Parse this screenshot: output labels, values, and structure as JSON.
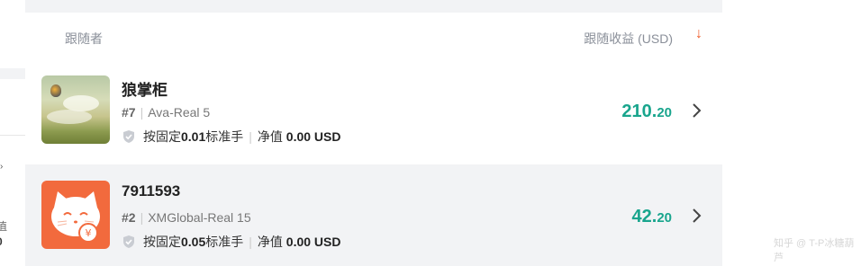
{
  "left_fragments": {
    "arrow": "›",
    "cut1": "值",
    "cut2": "0"
  },
  "header": {
    "follower_label": "跟随者",
    "profit_label": "跟随收益 (USD)",
    "sort_icon": "sort-desc-arrow"
  },
  "rows": [
    {
      "name": "狼掌柜",
      "rank": "#7",
      "account": "Ava-Real 5",
      "mode_label": "按固定",
      "lot_value": "0.01",
      "lot_unit": "标准手",
      "equity_label": "净值",
      "equity_value": "0.00 USD",
      "profit_int": "210.",
      "profit_dec": "20",
      "avatar": "landscape-balloon"
    },
    {
      "name": "7911593",
      "rank": "#2",
      "account": "XMGlobal-Real 15",
      "mode_label": "按固定",
      "lot_value": "0.05",
      "lot_unit": "标准手",
      "equity_label": "净值",
      "equity_value": "0.00 USD",
      "profit_int": "42.",
      "profit_dec": "20",
      "avatar": "lucky-cat"
    }
  ],
  "watermark": "知乎 @ T-P冰糖葫芦",
  "colors": {
    "profit": "#19a58d",
    "sort": "#f05a28",
    "cat_bg": "#f26a3d"
  }
}
